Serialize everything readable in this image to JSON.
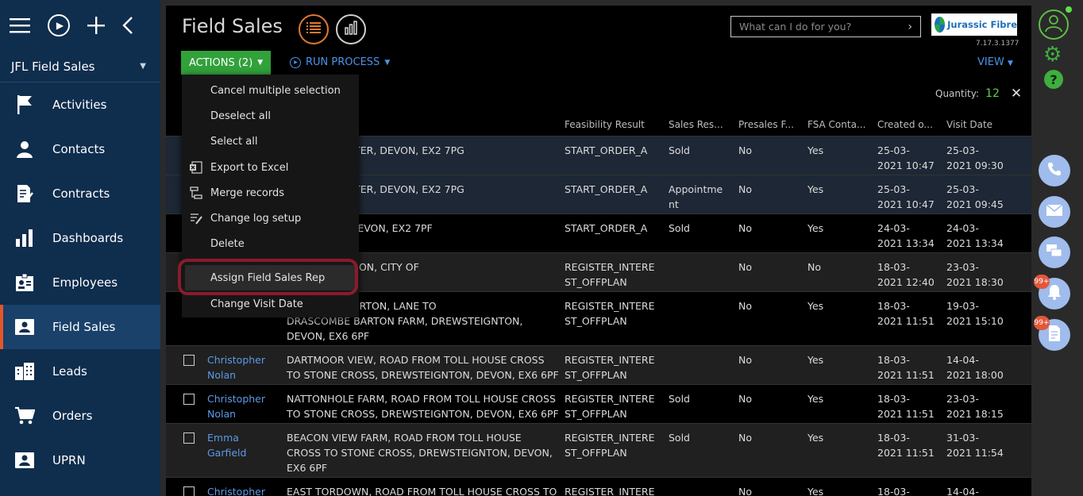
{
  "sidebar": {
    "app_name": "JFL Field Sales",
    "items": [
      {
        "label": "Activities",
        "icon": "flag-icon"
      },
      {
        "label": "Contacts",
        "icon": "person-icon"
      },
      {
        "label": "Contracts",
        "icon": "contract-icon"
      },
      {
        "label": "Dashboards",
        "icon": "bar-chart-icon"
      },
      {
        "label": "Employees",
        "icon": "badge-icon"
      },
      {
        "label": "Field Sales",
        "icon": "person-card-icon",
        "active": true
      },
      {
        "label": "Leads",
        "icon": "buildings-icon"
      },
      {
        "label": "Orders",
        "icon": "cart-icon"
      },
      {
        "label": "UPRN",
        "icon": "person-card-icon"
      }
    ]
  },
  "header": {
    "title": "Field Sales",
    "search_placeholder": "What can I do for you?",
    "logo_text": "Jurassic Fibre",
    "version": "7.17.3.1377"
  },
  "toolbar": {
    "actions_label": "ACTIONS (2)",
    "run_process_label": "RUN PROCESS",
    "view_label": "VIEW",
    "quantity_label": "Quantity:",
    "quantity_value": "12"
  },
  "dropdown": {
    "items": [
      {
        "label": "Cancel multiple selection",
        "icon": ""
      },
      {
        "label": "Deselect all",
        "icon": ""
      },
      {
        "label": "Select all",
        "icon": ""
      },
      {
        "label": "Export to Excel",
        "icon": "excel-icon"
      },
      {
        "label": "Merge records",
        "icon": "merge-icon"
      },
      {
        "label": "Change log setup",
        "icon": "log-icon"
      },
      {
        "label": "Delete",
        "icon": ""
      },
      {
        "label": "Assign Field Sales Rep",
        "icon": "",
        "highlighted": true
      },
      {
        "label": "Change Visit Date",
        "icon": ""
      }
    ]
  },
  "table": {
    "columns": [
      "Feasibility Result",
      "Sales Res...",
      "Presales F...",
      "FSA Conta...",
      "Created o...",
      "Visit Date"
    ],
    "rows": [
      {
        "name": "",
        "address": "E CLOSE, EXETER, DEVON, EX2 7PG",
        "feasibility": "START_ORDER_A",
        "sales": "Sold",
        "presales": "No",
        "fsa": "Yes",
        "created": "25-03-\n2021 10:47",
        "visit": "25-03-\n2021 09:30",
        "selected": true
      },
      {
        "name": "",
        "address": "E CLOSE, EXETER, DEVON, EX2 7PG",
        "feasibility": "START_ORDER_A",
        "sales": "Appointme\nnt",
        "presales": "No",
        "fsa": "Yes",
        "created": "25-03-\n2021 10:47",
        "visit": "25-03-\n2021 09:45",
        "selected": true
      },
      {
        "name": "",
        "address": "AY, EXETER, DEVON, EX2 7PF",
        "feasibility": "START_ORDER_A",
        "sales": "Sold",
        "presales": "No",
        "fsa": "Yes",
        "created": "24-03-\n2021 13:34",
        "visit": "24-03-\n2021 13:34"
      },
      {
        "name": "",
        "address": "STREET, LONDON, CITY OF\nSW1A 2AA",
        "feasibility": "REGISTER_INTERE\nST_OFFPLAN",
        "sales": "",
        "presales": "No",
        "fsa": "No",
        "created": "18-03-\n2021 12:40",
        "visit": "23-03-\n2021 18:30"
      },
      {
        "name": "",
        "address": "RASCOMBE BARTON, LANE TO\nDRASCOMBE BARTON FARM, DREWSTEIGNTON,\nDEVON, EX6 6PF",
        "feasibility": "REGISTER_INTERE\nST_OFFPLAN",
        "sales": "",
        "presales": "No",
        "fsa": "Yes",
        "created": "18-03-\n2021 11:51",
        "visit": "19-03-\n2021 15:10"
      },
      {
        "name": "Christopher\nNolan",
        "address": "DARTMOOR VIEW, ROAD FROM TOLL HOUSE CROSS\nTO STONE CROSS, DREWSTEIGNTON, DEVON, EX6 6PF",
        "feasibility": "REGISTER_INTERE\nST_OFFPLAN",
        "sales": "",
        "presales": "No",
        "fsa": "Yes",
        "created": "18-03-\n2021 11:51",
        "visit": "14-04-\n2021 18:00"
      },
      {
        "name": "Christopher\nNolan",
        "address": "NATTONHOLE FARM, ROAD FROM TOLL HOUSE CROSS\nTO STONE CROSS, DREWSTEIGNTON, DEVON, EX6 6PF",
        "feasibility": "REGISTER_INTERE\nST_OFFPLAN",
        "sales": "Sold",
        "presales": "No",
        "fsa": "Yes",
        "created": "18-03-\n2021 11:51",
        "visit": "23-03-\n2021 18:15"
      },
      {
        "name": "Emma\nGarfield",
        "address": "BEACON VIEW FARM, ROAD FROM TOLL HOUSE\nCROSS TO STONE CROSS, DREWSTEIGNTON, DEVON,\nEX6 6PF",
        "feasibility": "REGISTER_INTERE\nST_OFFPLAN",
        "sales": "Sold",
        "presales": "No",
        "fsa": "Yes",
        "created": "18-03-\n2021 11:51",
        "visit": "31-03-\n2021 11:54"
      },
      {
        "name": "Christopher",
        "address": "EAST TORDOWN, ROAD FROM TOLL HOUSE CROSS TO",
        "feasibility": "REGISTER_INTERE",
        "sales": "",
        "presales": "No",
        "fsa": "Yes",
        "created": "18-03-",
        "visit": "14-04-"
      }
    ]
  },
  "rightbar": {
    "notification_badge": "99+",
    "tasks_badge": "99+"
  },
  "colors": {
    "sidebar_bg": "#0f2d4d",
    "accent_green": "#31a13a",
    "link_blue": "#4c93e8",
    "highlight_ring": "#8a1b2b"
  }
}
